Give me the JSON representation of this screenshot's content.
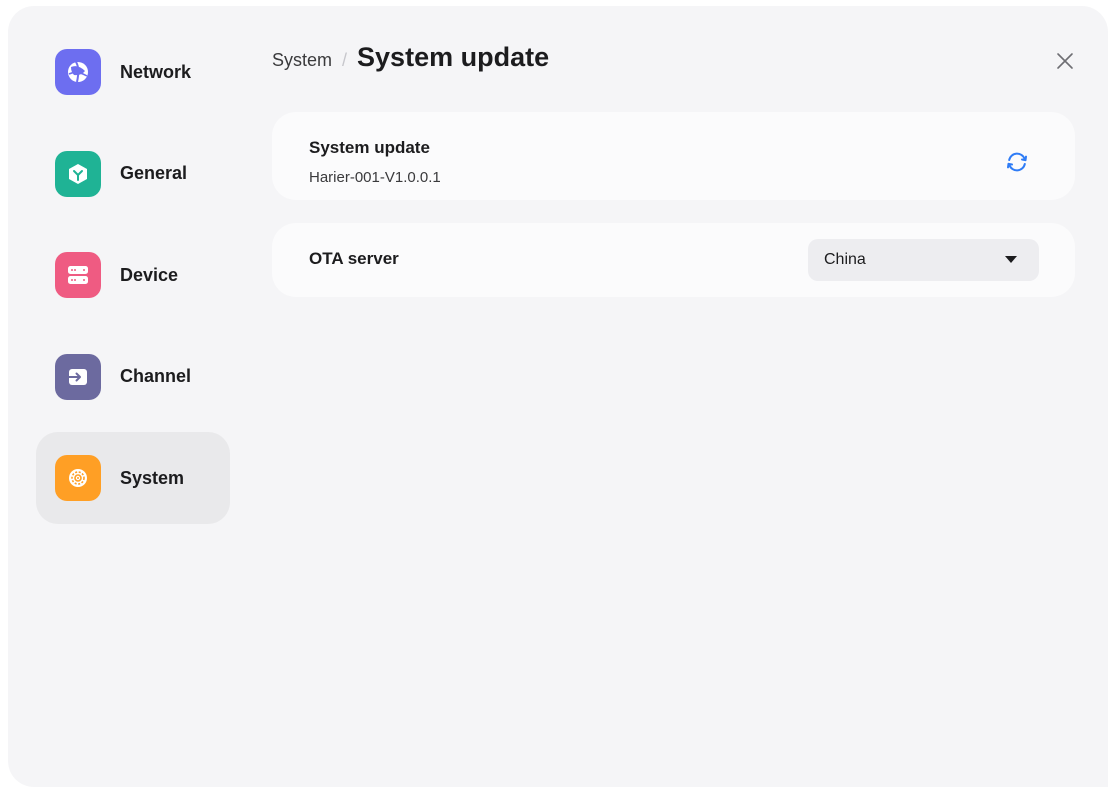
{
  "sidebar": {
    "items": [
      {
        "label": "Network",
        "icon": "network-icon",
        "color": "#6d6ef0",
        "active": false
      },
      {
        "label": "General",
        "icon": "general-icon",
        "color": "#1fb395",
        "active": false
      },
      {
        "label": "Device",
        "icon": "device-icon",
        "color": "#ef5b82",
        "active": false
      },
      {
        "label": "Channel",
        "icon": "channel-icon",
        "color": "#6c6a9f",
        "active": false
      },
      {
        "label": "System",
        "icon": "system-icon",
        "color": "#ff9f25",
        "active": true
      }
    ]
  },
  "header": {
    "breadcrumb_parent": "System",
    "breadcrumb_separator": "/",
    "title": "System update"
  },
  "update_card": {
    "title": "System update",
    "version": "Harier-001-V1.0.0.1",
    "refresh_icon": "refresh-icon"
  },
  "ota_card": {
    "label": "OTA server",
    "selected": "China"
  },
  "colors": {
    "accent": "#2f7cf6",
    "background": "#f5f5f7",
    "card": "#fbfbfc",
    "active_item": "#e9e9eb"
  }
}
